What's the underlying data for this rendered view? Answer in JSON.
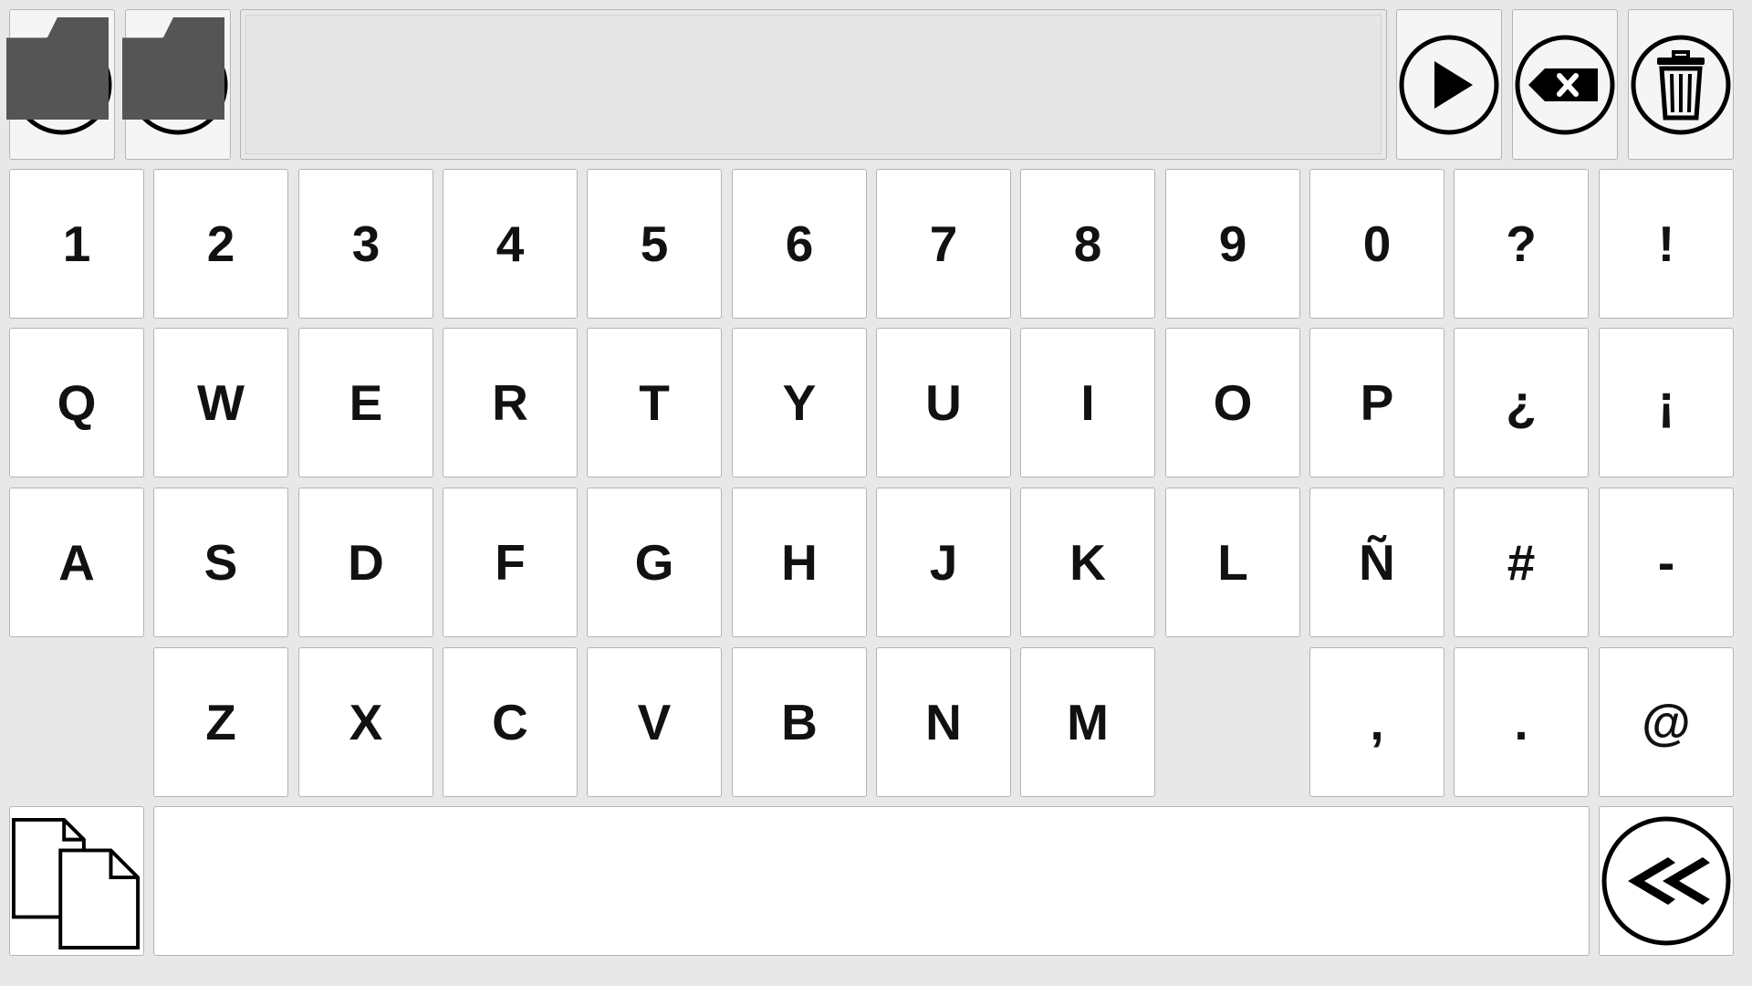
{
  "toolbar": {
    "home_icon": "home-icon",
    "reload_icon": "reload-icon",
    "play_icon": "play-icon",
    "backspace_icon": "backspace-icon",
    "trash_icon": "trash-icon"
  },
  "display": {
    "text": ""
  },
  "keyboard": {
    "row1": [
      "1",
      "2",
      "3",
      "4",
      "5",
      "6",
      "7",
      "8",
      "9",
      "0",
      "?",
      "!"
    ],
    "row2": [
      "Q",
      "W",
      "E",
      "R",
      "T",
      "Y",
      "U",
      "I",
      "O",
      "P",
      "¿",
      "¡"
    ],
    "row3": [
      "A",
      "S",
      "D",
      "F",
      "G",
      "H",
      "J",
      "K",
      "L",
      "Ñ",
      "#",
      "-"
    ],
    "row4_letters": [
      "Z",
      "X",
      "C",
      "V",
      "B",
      "N",
      "M"
    ],
    "row4_symbols": [
      ",",
      ".",
      "@"
    ],
    "copy_icon": "copy-icon",
    "space_label": "",
    "back_icon": "double-chevron-left-icon"
  }
}
